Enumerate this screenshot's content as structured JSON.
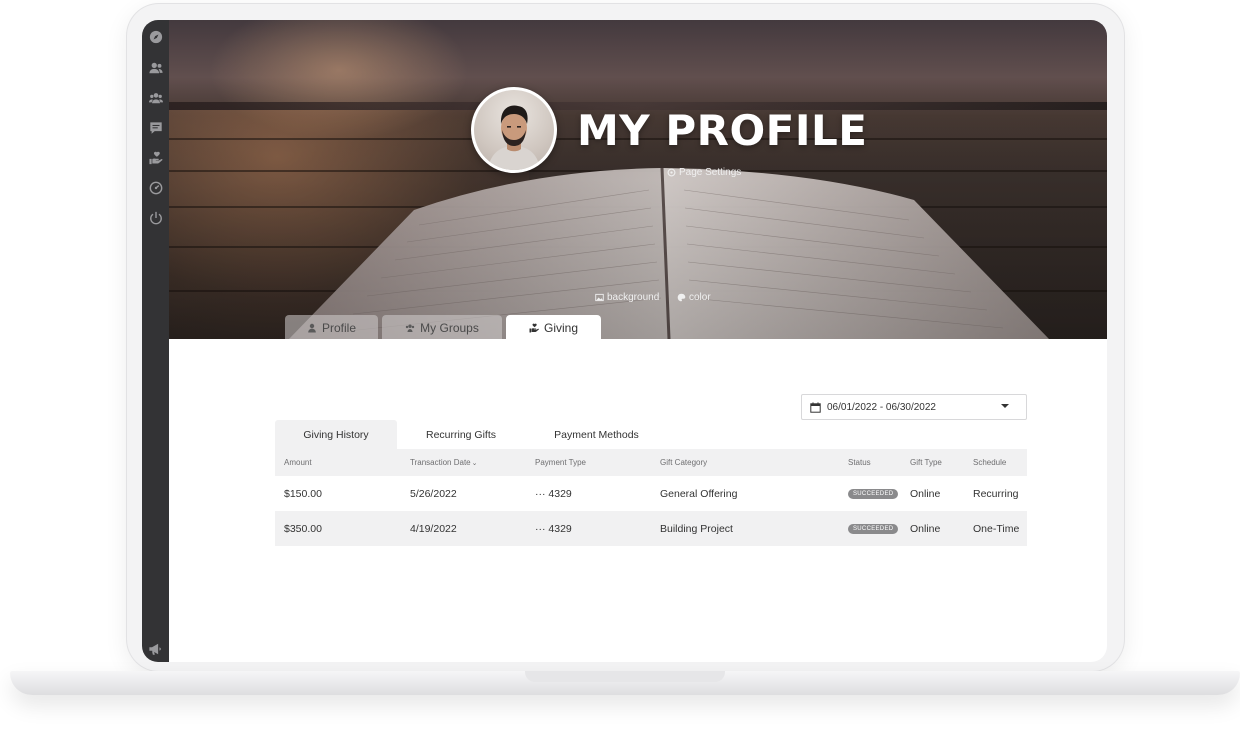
{
  "sidebar": {
    "icons": [
      "compass-icon",
      "user-group-icon",
      "users-icon",
      "chat-icon",
      "hand-heart-icon",
      "dashboard-icon",
      "power-icon"
    ],
    "bottom_icon": "bullhorn-icon"
  },
  "header": {
    "title": "MY PROFILE",
    "page_settings": "Page Settings",
    "background_label": "background",
    "color_label": "color"
  },
  "profile_tabs": [
    {
      "label": "Profile",
      "active": false
    },
    {
      "label": "My Groups",
      "active": false
    },
    {
      "label": "Giving",
      "active": true
    }
  ],
  "date_filter": {
    "value": "06/01/2022 - 06/30/2022"
  },
  "sub_tabs": [
    {
      "label": "Giving History",
      "active": true
    },
    {
      "label": "Recurring Gifts",
      "active": false
    },
    {
      "label": "Payment Methods",
      "active": false
    }
  ],
  "table": {
    "columns": [
      "Amount",
      "Transaction Date",
      "Payment Type",
      "Gift Category",
      "Status",
      "Gift Type",
      "Schedule"
    ],
    "rows": [
      {
        "amount": "$150.00",
        "date": "5/26/2022",
        "payment": "··· 4329",
        "category": "General Offering",
        "status": "SUCCEEDED",
        "gift_type": "Online",
        "schedule": "Recurring"
      },
      {
        "amount": "$350.00",
        "date": "4/19/2022",
        "payment": "··· 4329",
        "category": "Building Project",
        "status": "SUCCEEDED",
        "gift_type": "Online",
        "schedule": "One-Time"
      }
    ]
  },
  "colors": {
    "sidebar_bg": "#333335",
    "table_header_bg": "#f1f1f2",
    "badge_bg": "#8a8a8c"
  }
}
